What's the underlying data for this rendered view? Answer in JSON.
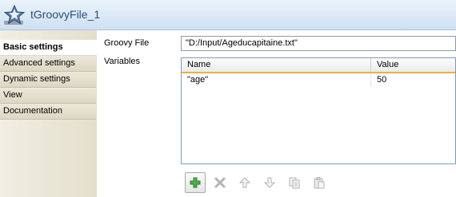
{
  "window": {
    "title": "tGroovyFile_1",
    "icon": "groovy-star-icon"
  },
  "sidebar": {
    "tabs": [
      {
        "label": "Basic settings",
        "active": true
      },
      {
        "label": "Advanced settings",
        "active": false
      },
      {
        "label": "Dynamic settings",
        "active": false
      },
      {
        "label": "View",
        "active": false
      },
      {
        "label": "Documentation",
        "active": false
      }
    ]
  },
  "form": {
    "groovy_file_label": "Groovy File",
    "groovy_file_value": "\"D:/Input/Ageducapitaine.txt\"",
    "variables_label": "Variables"
  },
  "table": {
    "columns": [
      "Name",
      "Value"
    ],
    "rows": [
      {
        "name": "\"age\"",
        "value": "50"
      }
    ]
  },
  "toolbar": {
    "buttons": [
      "add-icon",
      "delete-icon",
      "move-up-icon",
      "move-down-icon",
      "copy-icon",
      "paste-icon"
    ]
  },
  "colors": {
    "header_bg": "#dbe9f6",
    "title_text": "#2b4f7d",
    "sidebar_bg": "#e4dfcc",
    "table_header_accent": "#f0b040",
    "add_icon": "#3aa33a"
  }
}
